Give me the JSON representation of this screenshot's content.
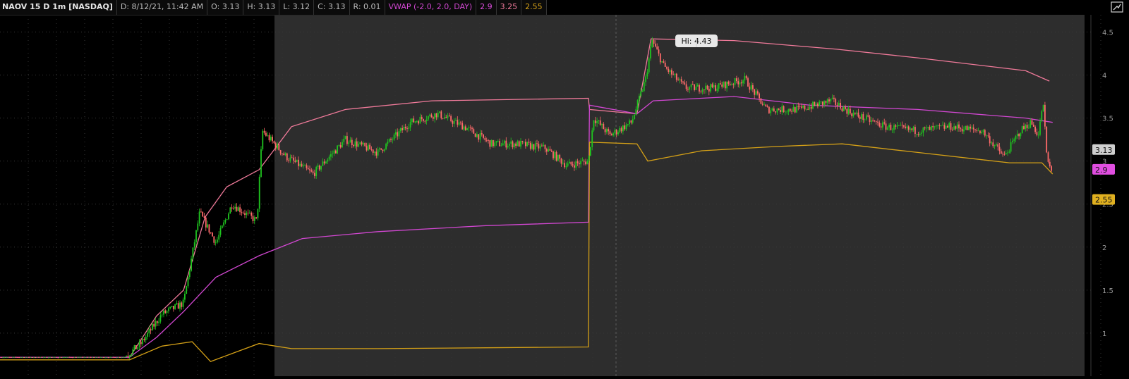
{
  "header": {
    "symbol": "NAOV 15 D 1m [NASDAQ]",
    "date": "D: 8/12/21, 11:42 AM",
    "open": "O: 3.13",
    "high": "H: 3.13",
    "low": "L: 3.12",
    "close": "C: 3.13",
    "range": "R: 0.01",
    "study": "VWAP (-2.0, 2.0, DAY)",
    "study_vwap": "2.9",
    "study_upper": "3.25",
    "study_lower": "2.55"
  },
  "colors": {
    "vwap": "#d147d1",
    "upper": "#f07a9a",
    "lower": "#d4a017",
    "up": "#1fc41f",
    "down": "#ff6a6a",
    "premarket_bg": "#000000",
    "session_bg": "#2d2d2d"
  },
  "chart_data": {
    "type": "candlestick",
    "ylim": [
      0.5,
      4.7
    ],
    "yticks": [
      "1",
      "1.5",
      "2",
      "2.5",
      "3",
      "3.5",
      "4",
      "4.5"
    ],
    "hi_label": "Hi: 4.43",
    "hi_value": 4.43,
    "price_labels": [
      {
        "name": "last",
        "text": "3.13",
        "value": 3.13,
        "color": "#cfcfcf"
      },
      {
        "name": "vwap",
        "text": "2.9",
        "value": 2.9,
        "color": "#e04ee0"
      },
      {
        "name": "lower",
        "text": "2.55",
        "value": 2.55,
        "color": "#e0b020"
      }
    ],
    "close_path": [
      [
        0,
        0.72
      ],
      [
        0.115,
        0.72
      ],
      [
        0.13,
        0.87
      ],
      [
        0.15,
        1.22
      ],
      [
        0.17,
        1.35
      ],
      [
        0.185,
        2.4
      ],
      [
        0.2,
        2.05
      ],
      [
        0.215,
        2.5
      ],
      [
        0.238,
        2.3
      ],
      [
        0.243,
        3.35
      ],
      [
        0.265,
        3.05
      ],
      [
        0.29,
        2.85
      ],
      [
        0.32,
        3.25
      ],
      [
        0.35,
        3.1
      ],
      [
        0.38,
        3.45
      ],
      [
        0.405,
        3.55
      ],
      [
        0.43,
        3.4
      ],
      [
        0.455,
        3.2
      ],
      [
        0.48,
        3.2
      ],
      [
        0.505,
        3.15
      ],
      [
        0.525,
        2.95
      ],
      [
        0.545,
        3.0
      ],
      [
        0.55,
        3.5
      ],
      [
        0.565,
        3.3
      ],
      [
        0.585,
        3.45
      ],
      [
        0.598,
        3.95
      ],
      [
        0.604,
        4.4
      ],
      [
        0.615,
        4.1
      ],
      [
        0.635,
        3.85
      ],
      [
        0.66,
        3.85
      ],
      [
        0.69,
        3.95
      ],
      [
        0.71,
        3.6
      ],
      [
        0.74,
        3.6
      ],
      [
        0.77,
        3.7
      ],
      [
        0.79,
        3.55
      ],
      [
        0.82,
        3.4
      ],
      [
        0.85,
        3.35
      ],
      [
        0.88,
        3.4
      ],
      [
        0.91,
        3.35
      ],
      [
        0.93,
        3.05
      ],
      [
        0.945,
        3.35
      ],
      [
        0.955,
        3.45
      ],
      [
        0.962,
        3.3
      ],
      [
        0.966,
        3.7
      ],
      [
        0.97,
        3.0
      ],
      [
        0.975,
        2.85
      ]
    ],
    "vwap_path": [
      [
        0,
        0.72
      ],
      [
        0.12,
        0.72
      ],
      [
        0.145,
        0.95
      ],
      [
        0.17,
        1.25
      ],
      [
        0.2,
        1.65
      ],
      [
        0.24,
        1.9
      ],
      [
        0.28,
        2.1
      ],
      [
        0.35,
        2.18
      ],
      [
        0.45,
        2.25
      ],
      [
        0.545,
        2.29
      ],
      [
        0.546,
        3.65
      ],
      [
        0.59,
        3.55
      ],
      [
        0.605,
        3.7
      ],
      [
        0.68,
        3.75
      ],
      [
        0.75,
        3.65
      ],
      [
        0.85,
        3.6
      ],
      [
        0.95,
        3.5
      ],
      [
        0.975,
        3.45
      ]
    ],
    "upper_path": [
      [
        0,
        0.72
      ],
      [
        0.12,
        0.72
      ],
      [
        0.145,
        1.2
      ],
      [
        0.17,
        1.5
      ],
      [
        0.19,
        2.35
      ],
      [
        0.21,
        2.7
      ],
      [
        0.24,
        2.9
      ],
      [
        0.27,
        3.4
      ],
      [
        0.32,
        3.6
      ],
      [
        0.4,
        3.7
      ],
      [
        0.545,
        3.73
      ],
      [
        0.546,
        3.6
      ],
      [
        0.59,
        3.55
      ],
      [
        0.603,
        4.42
      ],
      [
        0.68,
        4.4
      ],
      [
        0.775,
        4.3
      ],
      [
        0.85,
        4.2
      ],
      [
        0.95,
        4.05
      ],
      [
        0.972,
        3.93
      ]
    ],
    "lower_path": [
      [
        0,
        0.69
      ],
      [
        0.12,
        0.69
      ],
      [
        0.15,
        0.85
      ],
      [
        0.178,
        0.9
      ],
      [
        0.195,
        0.67
      ],
      [
        0.24,
        0.88
      ],
      [
        0.27,
        0.82
      ],
      [
        0.35,
        0.82
      ],
      [
        0.45,
        0.83
      ],
      [
        0.545,
        0.84
      ],
      [
        0.546,
        3.22
      ],
      [
        0.59,
        3.2
      ],
      [
        0.6,
        3.0
      ],
      [
        0.65,
        3.12
      ],
      [
        0.72,
        3.17
      ],
      [
        0.78,
        3.2
      ],
      [
        0.85,
        3.1
      ],
      [
        0.935,
        2.98
      ],
      [
        0.965,
        2.98
      ],
      [
        0.975,
        2.85
      ]
    ]
  }
}
